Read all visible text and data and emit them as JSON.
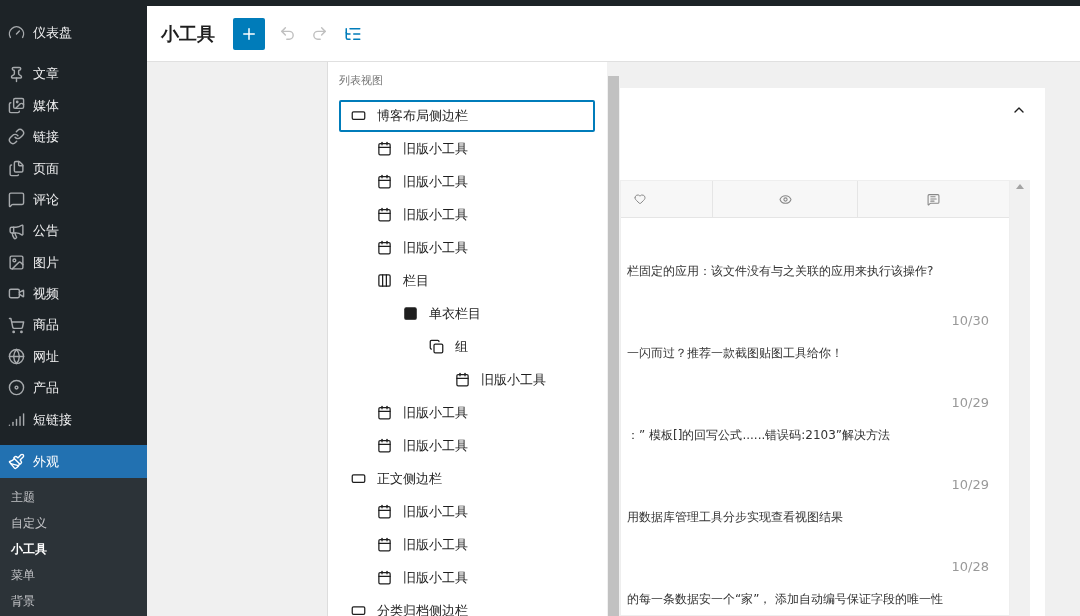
{
  "sidebar": {
    "items": [
      {
        "label": "仪表盘",
        "selected": false
      },
      {
        "label": "文章",
        "selected": false
      },
      {
        "label": "媒体",
        "selected": false
      },
      {
        "label": "链接",
        "selected": false
      },
      {
        "label": "页面",
        "selected": false
      },
      {
        "label": "评论",
        "selected": false
      },
      {
        "label": "公告",
        "selected": false
      },
      {
        "label": "图片",
        "selected": false
      },
      {
        "label": "视频",
        "selected": false
      },
      {
        "label": "商品",
        "selected": false
      },
      {
        "label": "网址",
        "selected": false
      },
      {
        "label": "产品",
        "selected": false
      },
      {
        "label": "短链接",
        "selected": false
      },
      {
        "label": "外观",
        "selected": true
      }
    ],
    "submenu": [
      {
        "label": "主题",
        "selected": false
      },
      {
        "label": "自定义",
        "selected": false
      },
      {
        "label": "小工具",
        "selected": true
      },
      {
        "label": "菜单",
        "selected": false
      },
      {
        "label": "背景",
        "selected": false
      }
    ]
  },
  "header": {
    "title": "小工具"
  },
  "list_view": {
    "title": "列表视图",
    "items": [
      {
        "kind": "area",
        "label": "博客布局侧边栏",
        "selected": true,
        "children": [
          {
            "kind": "widget",
            "label": "旧版小工具",
            "selected": false
          },
          {
            "kind": "widget",
            "label": "旧版小工具",
            "selected": false
          },
          {
            "kind": "widget",
            "label": "旧版小工具",
            "selected": false
          },
          {
            "kind": "widget",
            "label": "旧版小工具",
            "selected": false
          },
          {
            "kind": "columns",
            "label": "栏目",
            "selected": false,
            "children": [
              {
                "kind": "column",
                "label": "单衣栏目",
                "selected": false,
                "children": [
                  {
                    "kind": "group",
                    "label": "组",
                    "selected": false,
                    "children": [
                      {
                        "kind": "widget",
                        "label": "旧版小工具",
                        "selected": false
                      }
                    ]
                  }
                ]
              }
            ]
          },
          {
            "kind": "widget",
            "label": "旧版小工具",
            "selected": false
          },
          {
            "kind": "widget",
            "label": "旧版小工具",
            "selected": false
          }
        ]
      },
      {
        "kind": "area",
        "label": "正文侧边栏",
        "selected": false,
        "children": [
          {
            "kind": "widget",
            "label": "旧版小工具",
            "selected": false
          },
          {
            "kind": "widget",
            "label": "旧版小工具",
            "selected": false
          },
          {
            "kind": "widget",
            "label": "旧版小工具",
            "selected": false
          }
        ]
      },
      {
        "kind": "area",
        "label": "分类归档侧边栏",
        "selected": false
      }
    ]
  },
  "posts": [
    {
      "title": "栏固定的应用：该文件没有与之关联的应用来执行该操作?"
    },
    {
      "date": "10/30",
      "title": "一闪而过？推荐一款截图贴图工具给你！"
    },
    {
      "date": "10/29",
      "title": "：” 模板[]的回写公式......错误码:2103”解决方法"
    },
    {
      "date": "10/29",
      "title": "用数据库管理工具分步实现查看视图结果"
    },
    {
      "date": "10/28",
      "title": "的每一条数据安一个“家”， 添加自动编号保证字段的唯一性"
    }
  ]
}
